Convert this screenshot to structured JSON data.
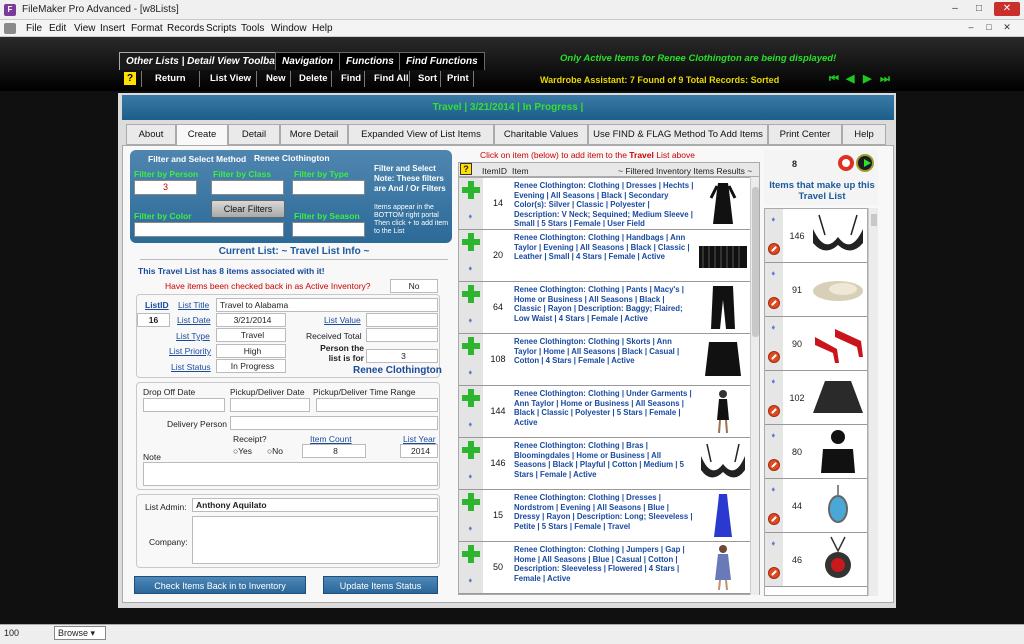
{
  "window": {
    "title": "FileMaker Pro Advanced - [w8Lists]",
    "controls": [
      "–",
      "□",
      "✕"
    ]
  },
  "menu": [
    "File",
    "Edit",
    "View",
    "Insert",
    "Format",
    "Records",
    "Scripts",
    "Tools",
    "Window",
    "Help"
  ],
  "toolbar": {
    "tabs": [
      "Other Lists | Detail View Toolbar",
      "Navigation",
      "Functions",
      "Find Functions"
    ],
    "buttons": [
      "Return",
      "List View",
      "New",
      "Delete",
      "Find",
      "Find All",
      "Sort",
      "Print"
    ],
    "help_icon": "?",
    "notice": "Only Active Items for Renee Clothington are being displayed!",
    "status": "Wardrobe Assistant:  7 Found of 9 Total Records: Sorted",
    "notice_color": "#27e027",
    "status_color": "#e8d800"
  },
  "header": {
    "title": "Travel | 3/21/2014 | In Progress |"
  },
  "tabs": [
    "About",
    "Create",
    "Detail",
    "More Detail",
    "Expanded View of List Items",
    "Charitable Values",
    "Use FIND & FLAG Method To Add Items",
    "Print Center",
    "Help"
  ],
  "filter": {
    "title": "Filter and Select Method",
    "person_name": "Renee Clothington",
    "by_person_label": "Filter by Person",
    "by_person_value": "3",
    "by_class_label": "Filter by Class",
    "by_type_label": "Filter by Type",
    "by_color_label": "Filter by Color",
    "by_season_label": "Filter by Season",
    "clear_button": "Clear Filters",
    "note_bold": "Filter and Select Note: These filters are And / Or Filters",
    "note_small": "Items  appear in the BOTTOM right portal Then click + to add item to the List"
  },
  "current_list": {
    "heading": "Current List: ~  Travel List Info  ~",
    "items_msg": "This Travel List has 8 items associated with it!",
    "checked_back_q": "Have items been checked back in as Active Inventory?",
    "checked_back_val": "No",
    "listid_label": "ListID",
    "listid_val": "16",
    "title_label": "List Title",
    "title_val": "Travel to Alabama",
    "date_label": "List Date",
    "date_val": "3/21/2014",
    "value_label": "List Value",
    "value_val": "",
    "type_label": "List Type",
    "type_val": "Travel",
    "received_label": "Received Total",
    "received_val": "",
    "priority_label": "List Priority",
    "priority_val": "High",
    "person_for_label": "Person the list is for",
    "person_for_val": "3",
    "status_label": "List Status",
    "status_val": "In Progress",
    "person_name": "Renee Clothington"
  },
  "delivery": {
    "dropoff_label": "Drop Off Date",
    "pickup_label": "Pickup/Deliver Date",
    "time_label": "Pickup/Deliver Time Range",
    "person_label": "Delivery Person",
    "receipt_label": "Receipt?",
    "yes_label": "Yes",
    "no_label": "No",
    "item_count_label": "Item Count",
    "item_count_val": "8",
    "list_year_label": "List Year",
    "list_year_val": "2014",
    "note_label": "Note"
  },
  "admin": {
    "admin_label": "List Admin:",
    "admin_val": "Anthony Aquilato",
    "company_label": "Company:"
  },
  "buttons": {
    "check_back": "Check Items Back in to Inventory",
    "update_status": "Update Items Status"
  },
  "items_list": {
    "instruction_prefix": "Click on item (below) to add item to the ",
    "instruction_bold": "Travel",
    "instruction_suffix": " List above",
    "col_id": "ItemID",
    "col_item": "Item",
    "col_results": "~ Filtered Inventory Items Results ~",
    "rows": [
      {
        "id": "14",
        "desc": "Renee Clothington: Clothing | Dresses | Hechts | Evening | All Seasons | Black | Secondary Color(s): Silver | Classic | Polyester | Description: V Neck; Sequined; Medium Sleeve | Small | 5 Stars | Female | User Field",
        "img": "dress-black"
      },
      {
        "id": "20",
        "desc": "Renee Clothington: Clothing | Handbags | Ann Taylor | Evening | All Seasons | Black | Classic | Leather | Small | 4 Stars | Female | Active",
        "img": "handbag"
      },
      {
        "id": "64",
        "desc": "Renee Clothington: Clothing | Pants | Macy's | Home or Business | All Seasons | Black | Classic | Rayon | Description: Baggy; Flaired; Low Waist | 4 Stars | Female | Active",
        "img": "pants"
      },
      {
        "id": "108",
        "desc": "Renee Clothington: Clothing | Skorts | Ann Taylor | Home | All Seasons | Black | Casual | Cotton | 4 Stars | Female | Active",
        "img": "skort"
      },
      {
        "id": "144",
        "desc": "Renee Clothington: Clothing | Under Garments | Ann Taylor | Home or Business | All Seasons | Black | Classic | Polyester | 5 Stars | Female | Active",
        "img": "undergarment"
      },
      {
        "id": "146",
        "desc": "Renee Clothington: Clothing | Bras | Bloomingdales | Home or Business | All Seasons | Black | Playful | Cotton | Medium | 5 Stars | Female | Active",
        "img": "bra"
      },
      {
        "id": "15",
        "desc": "Renee Clothington: Clothing | Dresses | Nordstrom | Evening | All Seasons | Blue | Dressy | Rayon | Description: Long; Sleeveless | Petite | 5 Stars | Female | Travel",
        "img": "dress-blue"
      },
      {
        "id": "50",
        "desc": "Renee Clothington: Clothing | Jumpers | Gap | Home | All Seasons | Blue | Casual | Cotton | Description: Sleeveless | Flowered | 4 Stars | Female | Active",
        "img": "jumper"
      }
    ]
  },
  "right_panel": {
    "count": "8",
    "title": "Items that make up this Travel List",
    "rows": [
      {
        "id": "146",
        "img": "bra"
      },
      {
        "id": "91",
        "img": "flats"
      },
      {
        "id": "90",
        "img": "red-heels"
      },
      {
        "id": "102",
        "img": "skirt"
      },
      {
        "id": "80",
        "img": "top"
      },
      {
        "id": "44",
        "img": "pendant"
      },
      {
        "id": "46",
        "img": "necklace"
      }
    ]
  },
  "statusbar": {
    "zoom": "100",
    "mode": "Browse"
  }
}
